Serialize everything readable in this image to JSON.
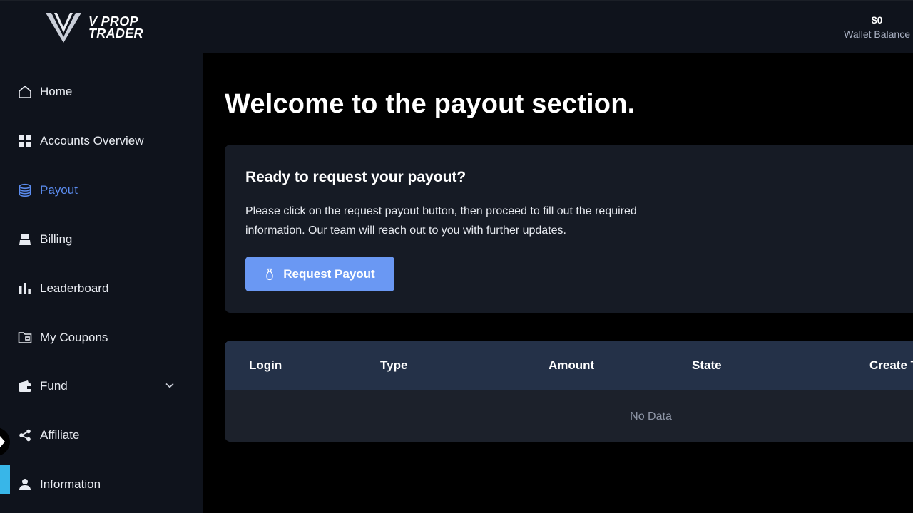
{
  "brand": {
    "line1": "V PROP",
    "line2": "TRADER",
    "logo_icon": "v-logo-icon"
  },
  "wallet": {
    "amount": "$0",
    "label": "Wallet Balance"
  },
  "sidebar": {
    "items": [
      {
        "label": "Home",
        "icon": "home-icon",
        "active": false
      },
      {
        "label": "Accounts Overview",
        "icon": "grid-icon",
        "active": false
      },
      {
        "label": "Payout",
        "icon": "database-icon",
        "active": true
      },
      {
        "label": "Billing",
        "icon": "cash-register-icon",
        "active": false
      },
      {
        "label": "Leaderboard",
        "icon": "bar-chart-icon",
        "active": false
      },
      {
        "label": "My Coupons",
        "icon": "folder-icon",
        "active": false
      },
      {
        "label": "Fund",
        "icon": "wallet-icon",
        "active": false,
        "expandable": true
      },
      {
        "label": "Affiliate",
        "icon": "share-icon",
        "active": false
      },
      {
        "label": "Information",
        "icon": "user-icon",
        "active": false
      }
    ]
  },
  "main": {
    "title": "Welcome to the payout section.",
    "card": {
      "title": "Ready to request your payout?",
      "description": "Please click on the request payout button, then proceed to fill out the required information. Our team will reach out to you with further updates.",
      "button_label": "Request Payout"
    },
    "table": {
      "columns": [
        "Login",
        "Type",
        "Amount",
        "State",
        "Create T"
      ],
      "empty_text": "No Data"
    }
  },
  "colors": {
    "accent": "#5b8cef",
    "button": "#6a98f3",
    "sidebar_bg": "#0f131c",
    "card_bg": "#161b25",
    "table_header_bg": "#243148"
  }
}
